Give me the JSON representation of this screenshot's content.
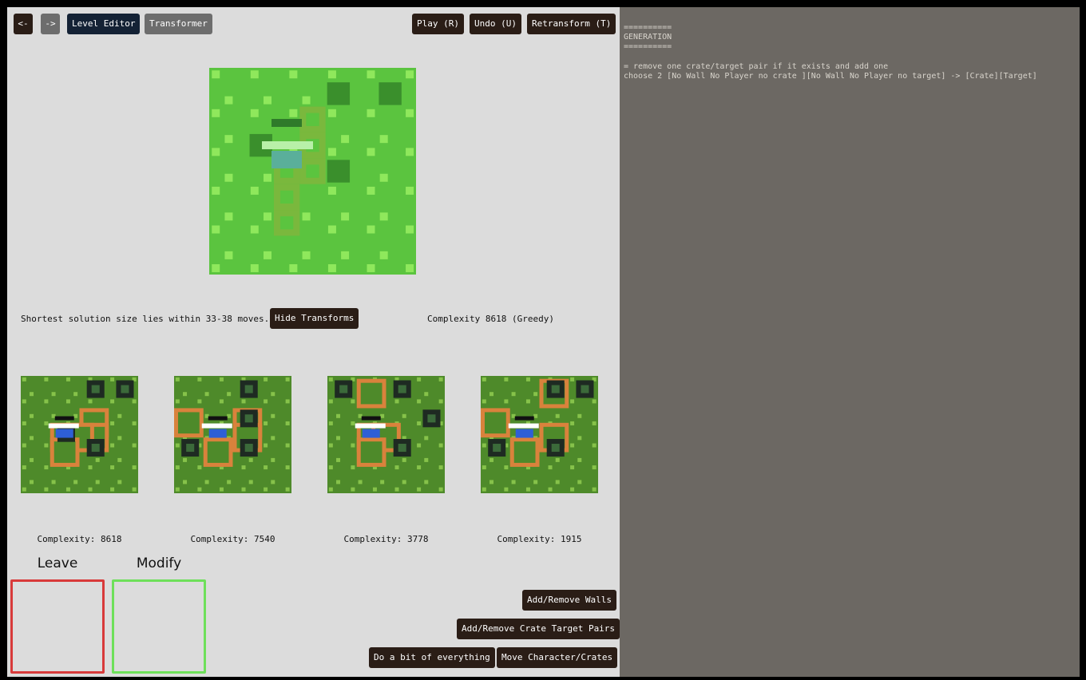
{
  "toolbar": {
    "prev_label": "<-",
    "next_label": "->",
    "level_editor_label": "Level Editor",
    "transformer_label": "Transformer",
    "play_label": "Play (R)",
    "undo_label": "Undo (U)",
    "retransform_label": "Retransform (T)"
  },
  "status": {
    "solution_text": "Shortest solution size lies within 33-38 moves.",
    "hide_transforms_label": "Hide Transforms",
    "complexity_text": "Complexity 8618 (Greedy)"
  },
  "variants": [
    {
      "complexity_label": "Complexity: 8618"
    },
    {
      "complexity_label": "Complexity: 7540"
    },
    {
      "complexity_label": "Complexity: 3778"
    },
    {
      "complexity_label": "Complexity: 1915"
    }
  ],
  "zones": {
    "leave_label": "Leave",
    "modify_label": "Modify"
  },
  "actions": {
    "walls_label": "Add/Remove Walls",
    "pairs_label": "Add/Remove Crate Target Pairs",
    "everything_label": "Do a bit of everything",
    "move_label": "Move Character/Crates"
  },
  "log": {
    "sep1": "==========",
    "heading": "GENERATION",
    "sep2": "==========",
    "rule_comment": "= remove one crate/target pair if it exists and add one",
    "rule_line": "choose 2 [No Wall No Player no crate ][No Wall No Player no target] -> [Crate][Target]"
  },
  "colors": {
    "panel_left": "#dcdcdc",
    "panel_right": "#6c6863",
    "button_dark": "#2a1d16",
    "button_navy": "#142235",
    "button_grey": "#6d6d6d",
    "leave_border": "#d83a3a",
    "modify_border": "#6ee05a",
    "preview_grass": "#5bc43f",
    "preview_dot": "#8fe85c",
    "variant_grass": "#4e8a2a",
    "variant_dot": "#86c24a",
    "crate_orange": "#d9823c",
    "target_dark": "#1e2a22"
  },
  "icons": {
    "preview_player": "player-sprite",
    "variant_player": "player-sprite",
    "crate": "crate-tile",
    "target": "target-tile"
  }
}
